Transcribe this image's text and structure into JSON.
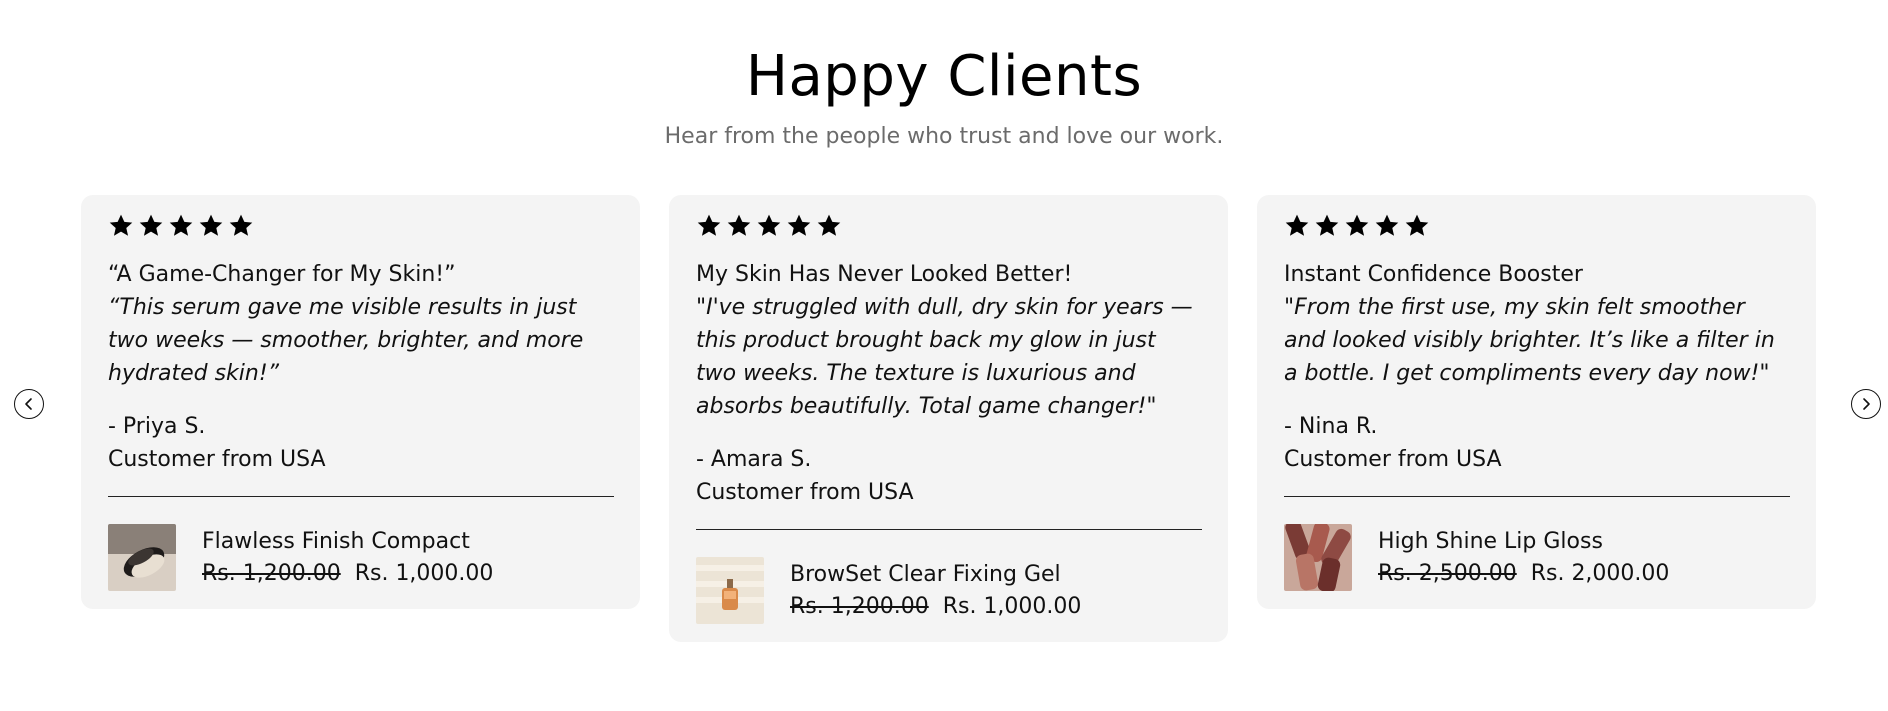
{
  "section": {
    "title": "Happy Clients",
    "subtitle": "Hear from the people who trust and love our work."
  },
  "icons": {
    "prev": "chevron-left-icon",
    "next": "chevron-right-icon",
    "star": "star-icon"
  },
  "colors": {
    "card_background": "#f4f4f4",
    "subtitle": "#6b6b6b",
    "text": "#111111"
  },
  "reviews": [
    {
      "rating": 5,
      "title": "“A Game-Changer for My Skin!”",
      "text": "“This serum gave me visible results in just two weeks — smoother, brighter, and more hydrated skin!”",
      "author": "- Priya S.",
      "location": "Customer from USA",
      "product": {
        "name": "Flawless Finish Compact",
        "old_price": "Rs. 1,200.00",
        "new_price": "Rs. 1,000.00"
      }
    },
    {
      "rating": 5,
      "title": "My Skin Has Never Looked Better!",
      "text": "\"I've struggled with dull, dry skin for years — this product brought back my glow in just two weeks. The texture is luxurious and absorbs beautifully. Total game changer!\"",
      "author": "- Amara S.",
      "location": "Customer from USA",
      "product": {
        "name": "BrowSet Clear Fixing Gel",
        "old_price": "Rs. 1,200.00",
        "new_price": "Rs. 1,000.00"
      }
    },
    {
      "rating": 5,
      "title": "Instant Confidence Booster",
      "text": "\"From the first use, my skin felt smoother and looked visibly brighter. It’s like a filter in a bottle. I get compliments every day now!\"",
      "author": "- Nina R.",
      "location": "Customer from USA",
      "product": {
        "name": "High Shine Lip Gloss",
        "old_price": "Rs. 2,500.00",
        "new_price": "Rs. 2,000.00"
      }
    }
  ]
}
